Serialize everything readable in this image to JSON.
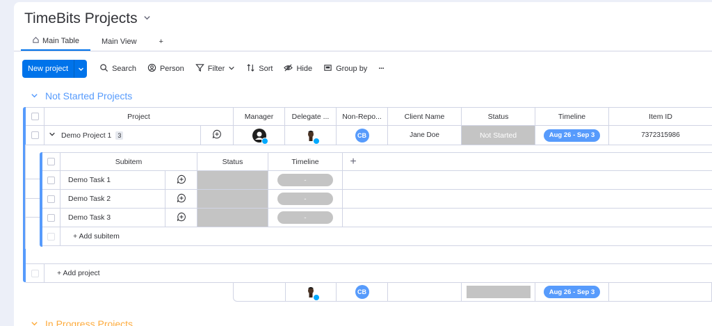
{
  "board": {
    "title": "TimeBits Projects"
  },
  "tabs": [
    {
      "label": "Main Table"
    },
    {
      "label": "Main View"
    },
    {
      "label": "+"
    }
  ],
  "toolbar": {
    "new_project": "New project",
    "search": "Search",
    "person": "Person",
    "filter": "Filter",
    "sort": "Sort",
    "hide": "Hide",
    "group_by": "Group by",
    "more": "···"
  },
  "group1": {
    "title": "Not Started Projects",
    "color": "#579bfc",
    "columns": {
      "project": "Project",
      "manager": "Manager",
      "delegate": "Delegate ...",
      "non_repo": "Non-Repo...",
      "client": "Client Name",
      "status": "Status",
      "timeline": "Timeline",
      "item_id": "Item ID"
    },
    "row": {
      "name": "Demo Project 1",
      "subitem_count": "3",
      "non_repo_initials": "CB",
      "client": "Jane Doe",
      "status": "Not Started",
      "timeline": "Aug 26 - Sep 3",
      "item_id": "7372315986"
    },
    "subitems": {
      "columns": {
        "subitem": "Subitem",
        "status": "Status",
        "timeline": "Timeline",
        "add": "+"
      },
      "rows": [
        {
          "name": "Demo Task 1",
          "timeline": "-"
        },
        {
          "name": "Demo Task 2",
          "timeline": "-"
        },
        {
          "name": "Demo Task 3",
          "timeline": "-"
        }
      ],
      "add_label": "+ Add subitem"
    },
    "add_project": "+ Add project",
    "summary": {
      "non_repo_initials": "CB",
      "timeline": "Aug 26 - Sep 3"
    }
  },
  "group2": {
    "title": "In Progress Projects",
    "color": "#fdab3d"
  },
  "colors": {
    "accent": "#0073ea",
    "status_empty": "#c4c4c4",
    "timeline": "#579bfc"
  }
}
